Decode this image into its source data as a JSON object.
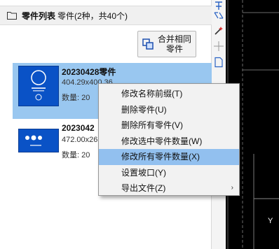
{
  "panel": {
    "title": "零件列表",
    "count_text": "零件(2种，共40个)",
    "merge_button": {
      "line1": "合并相同",
      "line2": "零件"
    }
  },
  "parts": [
    {
      "name": "20230428零件",
      "dims": "404.29x400.36",
      "qty_label": "数量: 20",
      "selected": true
    },
    {
      "name": "2023042",
      "dims": "472.00x26",
      "qty_label": "数量: 20",
      "selected": false
    }
  ],
  "context_menu": {
    "items": [
      {
        "label": "修改名称前缀(T)"
      },
      {
        "label": "删除零件(U)"
      },
      {
        "label": "删除所有零件(V)"
      },
      {
        "label": "修改选中零件数量(W)"
      },
      {
        "label": "修改所有零件数量(X)",
        "highlighted": true
      },
      {
        "label": "设置坡口(Y)"
      },
      {
        "label": "导出文件(Z)",
        "submenu_arrow": "›"
      }
    ]
  },
  "canvas": {
    "axis_label": "Y"
  },
  "colors": {
    "selection": "#99c7f0",
    "menu_highlight": "#92c0ef",
    "thumbnail": "#0a52c6",
    "canvas_bg": "#000000"
  },
  "icons": [
    "folder-icon",
    "merge-icon",
    "hand-icon",
    "scale-icon",
    "magic-wand-icon",
    "crosshair-icon",
    "page-icon"
  ]
}
